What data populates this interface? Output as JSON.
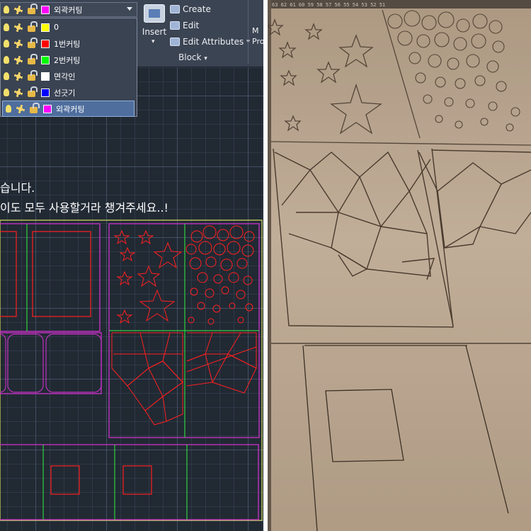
{
  "ribbon": {
    "create_label": "Create",
    "edit_label": "Edit",
    "edit_attributes_label": "Edit Attributes",
    "insert_label": "Insert",
    "block_panel_label": "Block",
    "clipped_right_label": "M\nPro"
  },
  "layer_dropdown": {
    "current_layer": "외곽커팅",
    "current_color": "#ff00ff",
    "layers": [
      {
        "name": "0",
        "color": "#ffff00"
      },
      {
        "name": "1번커팅",
        "color": "#ff0000"
      },
      {
        "name": "2번커팅",
        "color": "#00ff00"
      },
      {
        "name": "면각인",
        "color": "#ffffff"
      },
      {
        "name": "선긋기",
        "color": "#0000ff"
      },
      {
        "name": "외곽커팅",
        "color": "#ff00ff",
        "selected": true
      }
    ]
  },
  "canvas_text": {
    "line1": "습니다.",
    "line2": "이도 모두 사용할거라 챙겨주세요..!"
  },
  "colors": {
    "cad_background": "#212933",
    "ribbon_background": "#3b4453",
    "magenta": "#c030c0",
    "red": "#ff2020",
    "green": "#30d040",
    "yellow": "#d8e060",
    "mdf_board": "#c2ad95"
  },
  "photo": {
    "ruler_numbers": "63 62 61 60 59 58 57 56 55 54 53 52 51"
  }
}
